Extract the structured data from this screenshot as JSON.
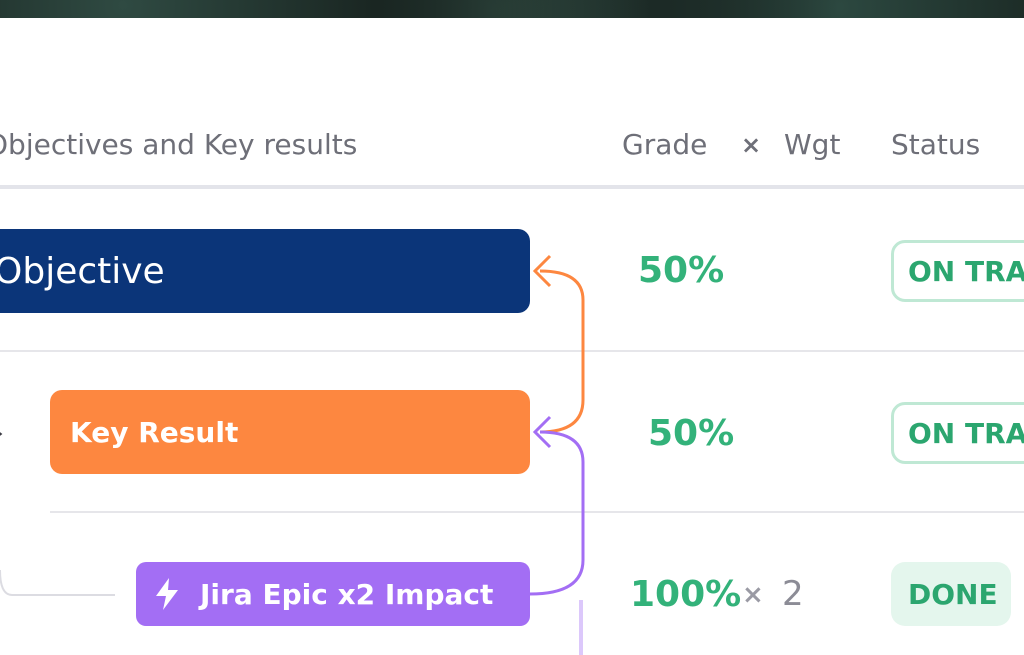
{
  "header": {
    "title": "Objectives and Key results",
    "grade": "Grade",
    "times": "×",
    "wgt": "Wgt",
    "status": "Status"
  },
  "rows": [
    {
      "label": "Objective",
      "grade": "50%",
      "status": "ON TRACK"
    },
    {
      "label": "Key Result",
      "grade": "50%",
      "status": "ON TRACK"
    },
    {
      "label": "Jira Epic x2 Impact",
      "grade": "100%",
      "times": "×",
      "weight": "2",
      "status": "DONE",
      "icon": "lightning-bolt-icon"
    }
  ],
  "colors": {
    "objective": "#0b3579",
    "key_result": "#fd8740",
    "epic": "#a36ef4",
    "grade_green": "#33b27a",
    "status_border": "#bfe8d4",
    "done_bg": "#e4f6ed"
  }
}
